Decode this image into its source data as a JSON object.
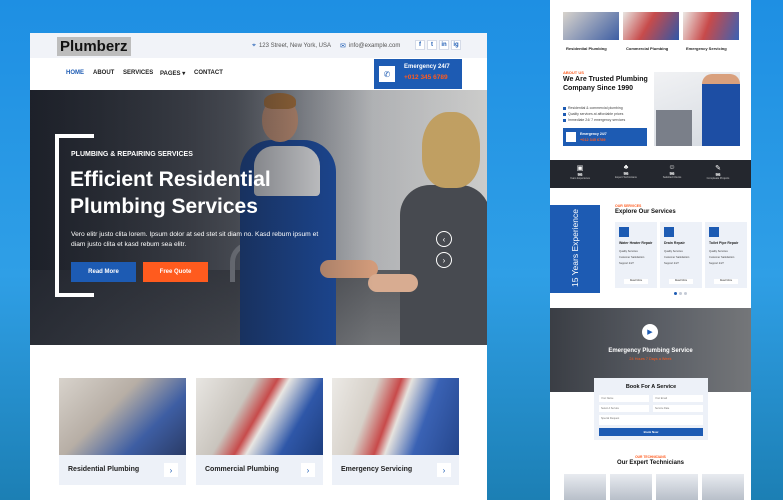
{
  "header": {
    "logo": "Plumberz",
    "address": "123 Street, New York, USA",
    "email": "info@example.com",
    "social": [
      "f",
      "t",
      "in",
      "ig"
    ]
  },
  "nav": {
    "items": [
      "HOME",
      "ABOUT",
      "SERVICES",
      "PAGES",
      "CONTACT"
    ],
    "pages_chevron": "▾"
  },
  "emergency": {
    "title": "Emergency 24/7",
    "phone": "+012 345 6789"
  },
  "hero": {
    "eyebrow": "PLUMBING & REPAIRING SERVICES",
    "title": "Efficient Residential Plumbing Services",
    "text": "Vero elitr justo clita lorem. Ipsum dolor at sed stet sit diam no. Kasd rebum ipsum et diam justo clita et kasd rebum sea elitr.",
    "read_more": "Read More",
    "free_quote": "Free Quote",
    "prev_arrow": "‹",
    "next_arrow": "›"
  },
  "services": [
    {
      "label": "Residential Plumbing",
      "arrow": "›"
    },
    {
      "label": "Commercial Plumbing",
      "arrow": "›"
    },
    {
      "label": "Emergency Servicing",
      "arrow": "›"
    }
  ],
  "right": {
    "services_mini": [
      "Residential Plumbing",
      "Commercial Plumbing",
      "Emergency Servicing"
    ],
    "about": {
      "eyebrow": "ABOUT US",
      "title": "We Are Trusted Plumbing Company Since 1990",
      "checks": [
        "Residential & commercial plumbing",
        "Quality services at affordable prices",
        "Immediate 24/ 7 emergency services"
      ],
      "em_title": "Emergency 24/7",
      "em_phone": "+012 345 6789"
    },
    "stats": [
      {
        "num": "96",
        "label": "Years Experience"
      },
      {
        "num": "96",
        "label": "Expert Technicians"
      },
      {
        "num": "96",
        "label": "Satisfied Clients"
      },
      {
        "num": "96",
        "label": "Compleate Projects"
      }
    ],
    "years_text": "15 Years Experience",
    "services_section": {
      "eyebrow": "OUR SERVICES",
      "title": "Explore Our Services",
      "cards": [
        {
          "title": "Water Heater Repair",
          "lines": [
            "Quality Services",
            "Customer Satisfaction",
            "Support 24/7"
          ],
          "btn": "Read More"
        },
        {
          "title": "Drain Repair",
          "lines": [
            "Quality Services",
            "Customer Satisfaction",
            "Support 24/7"
          ],
          "btn": "Read More"
        },
        {
          "title": "Toilet Pipe Repair",
          "lines": [
            "Quality Services",
            "Customer Satisfaction",
            "Support 24/7"
          ],
          "btn": "Read More"
        }
      ]
    },
    "video": {
      "title": "Emergency Plumbing Service",
      "sub": "24 Hours 7 Days a Week"
    },
    "booking": {
      "title": "Book For A Service",
      "fields": [
        "Your Name",
        "Your Email",
        "Select A Service",
        "Service Date",
        "Special Request"
      ],
      "button": "Book Now"
    },
    "team": {
      "eyebrow": "OUR TECHNICIANS",
      "title": "Our Expert Technicians"
    }
  },
  "colors": {
    "primary": "#1d5bb3",
    "accent": "#ff5b1e",
    "background": "#2596e6"
  },
  "icons": {
    "location": "location-pin-icon",
    "email": "envelope-icon",
    "phone": "phone-icon",
    "arrow": "arrow-right-icon"
  }
}
